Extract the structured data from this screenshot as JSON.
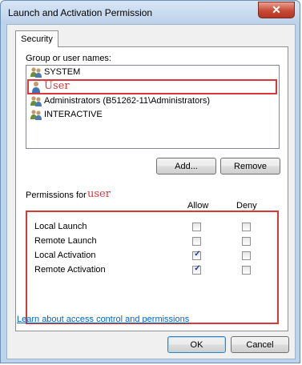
{
  "window": {
    "title": "Launch and Activation Permission",
    "close_glyph": "✕"
  },
  "tabs": [
    {
      "label": "Security"
    }
  ],
  "users": {
    "label": "Group or user names:",
    "items": [
      {
        "name": "SYSTEM",
        "icon": "group-users-icon",
        "color": "#000000"
      },
      {
        "name": "User",
        "icon": "user-icon",
        "color": "#d9383a"
      },
      {
        "name": "Administrators (B51262-11\\Administrators)",
        "icon": "group-users-icon",
        "color": "#000000"
      },
      {
        "name": "INTERACTIVE",
        "icon": "group-users-icon",
        "color": "#000000"
      }
    ]
  },
  "buttons": {
    "add": "Add...",
    "remove": "Remove",
    "ok": "OK",
    "cancel": "Cancel"
  },
  "permissions": {
    "label_prefix": "Permissions for",
    "label_user": "user",
    "col_allow": "Allow",
    "col_deny": "Deny",
    "rows": [
      {
        "name": "Local Launch",
        "allow": false,
        "deny": false
      },
      {
        "name": "Remote Launch",
        "allow": false,
        "deny": false
      },
      {
        "name": "Local Activation",
        "allow": true,
        "deny": false
      },
      {
        "name": "Remote Activation",
        "allow": true,
        "deny": false
      }
    ]
  },
  "learn_link": "Learn about access control and permissions",
  "colors": {
    "highlight_red": "#d9383a",
    "link_blue": "#0066cc",
    "close_red": "#c74a35"
  }
}
